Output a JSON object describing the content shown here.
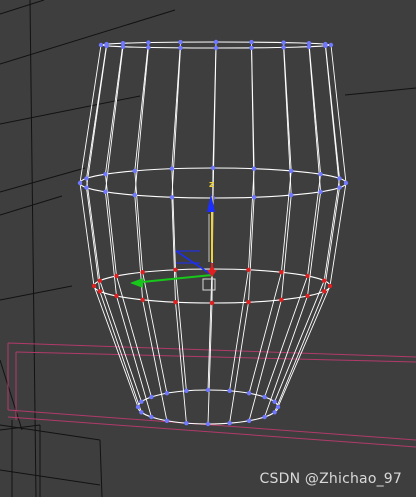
{
  "viewport": {
    "background_color": "#3e3e3e",
    "wire_color": "#ffffff",
    "grid_color": "#111111",
    "box_outline_color": "#b13a6a"
  },
  "gizmo": {
    "z_axis_label": "z",
    "z_color": "#f0d23a",
    "x_color": "#17c81a",
    "y_color": "#1a2fff"
  },
  "vertex_colors": {
    "unselected": "#6f78ff",
    "selected": "#e02020"
  },
  "watermark": {
    "text": "CSDN @Zhichao_97"
  }
}
